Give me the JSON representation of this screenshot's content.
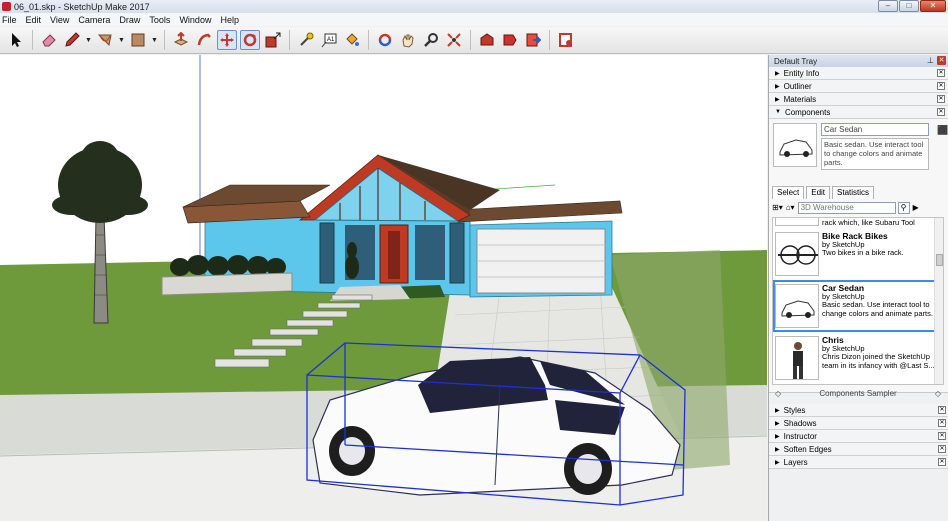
{
  "window": {
    "title": "06_01.skp - SketchUp Make 2017"
  },
  "menu": [
    "File",
    "Edit",
    "View",
    "Camera",
    "Draw",
    "Tools",
    "Window",
    "Help"
  ],
  "toolbar": {
    "tools": [
      "select-tool",
      "eraser-tool",
      "pencil-tool",
      "arc-tool",
      "shape-tool",
      "push-pull-tool",
      "follow-me-tool",
      "move-tool",
      "rotate-tool",
      "scale-tool",
      "tape-measure-tool",
      "text-tool",
      "paint-bucket-tool",
      "orbit-tool",
      "pan-tool",
      "zoom-tool",
      "zoom-extents-tool",
      "warehouse-tool",
      "extension-warehouse-tool",
      "send-to-layout-tool",
      "extension-manager-tool"
    ]
  },
  "tray": {
    "title": "Default Tray",
    "panels_top": [
      "Entity Info",
      "Outliner",
      "Materials"
    ],
    "components": {
      "title": "Components",
      "selected": {
        "name": "Car Sedan",
        "description": "Basic sedan. Use interact tool to change colors and animate parts."
      },
      "tabs": [
        "Select",
        "Edit",
        "Statistics"
      ],
      "search_placeholder": "3D Warehouse",
      "partial_top": "rack which, like Subaru Tool",
      "items": [
        {
          "name": "Bike Rack Bikes",
          "by": "by SketchUp",
          "desc": "Two bikes in a bike rack."
        },
        {
          "name": "Car Sedan",
          "by": "by SketchUp",
          "desc": "Basic sedan.  Use interact tool to change colors and animate parts."
        },
        {
          "name": "Chris",
          "by": "by SketchUp",
          "desc": "Chris Dizon joined the SketchUp team in its infancy with @Last S..."
        }
      ],
      "sampler": "Components Sampler"
    },
    "panels_bottom": [
      "Styles",
      "Shadows",
      "Instructor",
      "Soften Edges",
      "Layers"
    ]
  },
  "colors": {
    "accent": "#3b8be8",
    "selection_box": "#1f2fd6",
    "grass": "#6e9a3c",
    "house_wall": "#5cc7ea",
    "roof": "#bf3a22"
  }
}
